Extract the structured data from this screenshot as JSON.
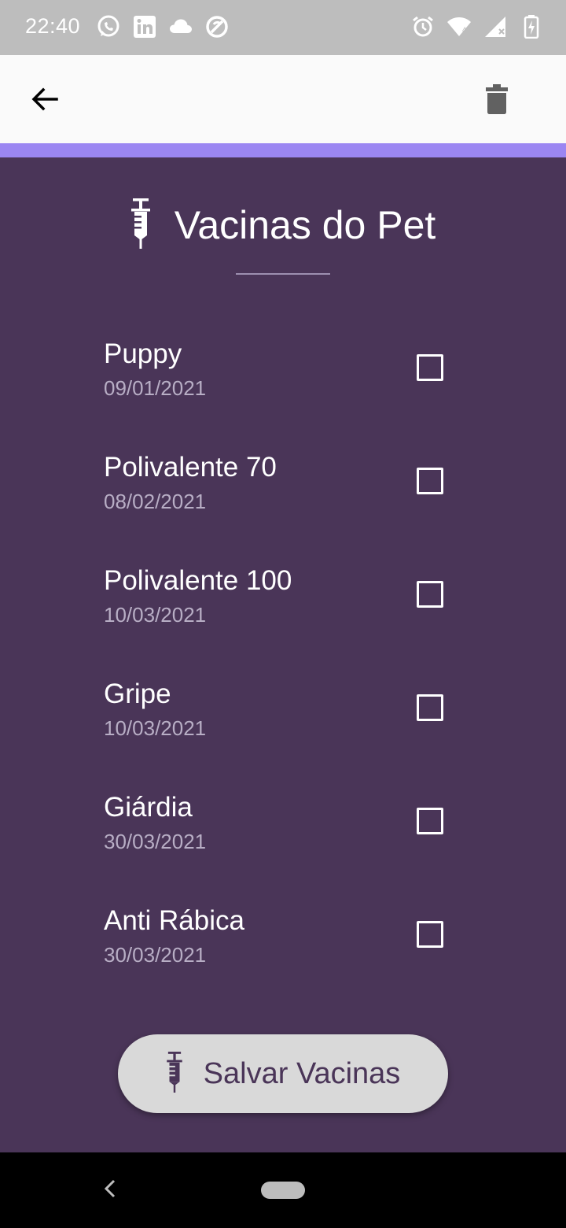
{
  "status_bar": {
    "time": "22:40",
    "left_icons": [
      "whatsapp-icon",
      "linkedin-icon",
      "cloud-icon",
      "sync-disabled-icon"
    ],
    "right_icons": [
      "alarm-icon",
      "wifi-icon",
      "signal-icon",
      "battery-charging-icon"
    ]
  },
  "app_bar": {
    "back_icon": "arrow-left-icon",
    "delete_icon": "trash-icon"
  },
  "header": {
    "title": "Vacinas do Pet",
    "icon": "syringe-icon"
  },
  "vaccines": [
    {
      "name": "Puppy",
      "date": "09/01/2021",
      "checked": false
    },
    {
      "name": "Polivalente 70",
      "date": "08/02/2021",
      "checked": false
    },
    {
      "name": "Polivalente 100",
      "date": "10/03/2021",
      "checked": false
    },
    {
      "name": "Gripe",
      "date": "10/03/2021",
      "checked": false
    },
    {
      "name": "Giárdia",
      "date": "30/03/2021",
      "checked": false
    },
    {
      "name": "Anti Rábica",
      "date": "30/03/2021",
      "checked": false
    }
  ],
  "save_button": {
    "label": "Salvar Vacinas",
    "icon": "syringe-icon"
  },
  "colors": {
    "background": "#4a3558",
    "accent": "#9b86f2",
    "app_bar": "#fafafa",
    "status_bar": "#bdbdbd",
    "button": "#d9d9d9"
  }
}
